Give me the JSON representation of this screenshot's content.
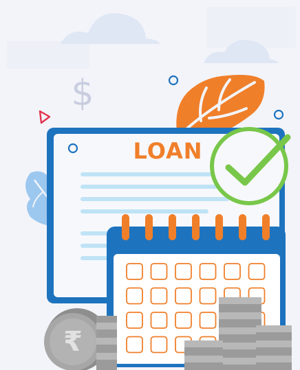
{
  "document": {
    "title": "LOAN"
  },
  "symbols": {
    "currency": "₹",
    "dollar": "$"
  },
  "colors": {
    "background": "#f3f4f9",
    "cloud": "#dfe7f5",
    "document_frame": "#1e73be",
    "document_paper": "#f7f8fc",
    "document_lines": "#bfe3f5",
    "loan_text": "#f07f2a",
    "check_green": "#78c74a",
    "calendar_blue": "#1e73be",
    "calendar_rings": "#f07f2a",
    "calendar_cells": "#f07f2a",
    "leaf_orange": "#f07f2a",
    "leaf_blue": "#9cc7ef",
    "coin_grey": "#a7a7a7"
  },
  "icons": [
    "cloud-icon",
    "dollar-icon",
    "document-icon",
    "check-icon",
    "calendar-icon",
    "rupee-coin-icon",
    "coin-stack-icon",
    "leaf-icon",
    "triangle-icon",
    "circle-icon"
  ]
}
